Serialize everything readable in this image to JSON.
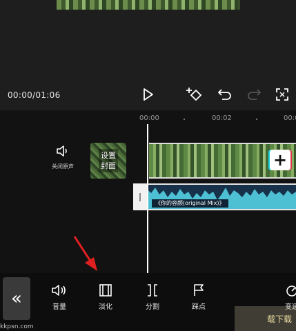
{
  "player": {
    "time": "00:00/01:06"
  },
  "ruler": {
    "labels": [
      "00:00",
      "00:02",
      "00:0"
    ]
  },
  "track": {
    "mute_label": "关闭原声",
    "cover_label_line1": "设置",
    "cover_label_line2": "封面",
    "add_symbol": "+",
    "audio_label": "《你的容颜(original Mix)》"
  },
  "toolbar": {
    "back_symbol": "«",
    "items": [
      {
        "label": "音量",
        "icon": "volume-icon"
      },
      {
        "label": "淡化",
        "icon": "fade-icon"
      },
      {
        "label": "分割",
        "icon": "split-icon"
      },
      {
        "label": "踩点",
        "icon": "flag-icon"
      },
      {
        "label": "变速",
        "icon": "speed-icon"
      }
    ]
  },
  "watermark": {
    "site": "kkpsn.com",
    "logo_text": "载下载"
  },
  "colors": {
    "accent_audio": "#4ec0d4",
    "arrow": "#e02020"
  }
}
